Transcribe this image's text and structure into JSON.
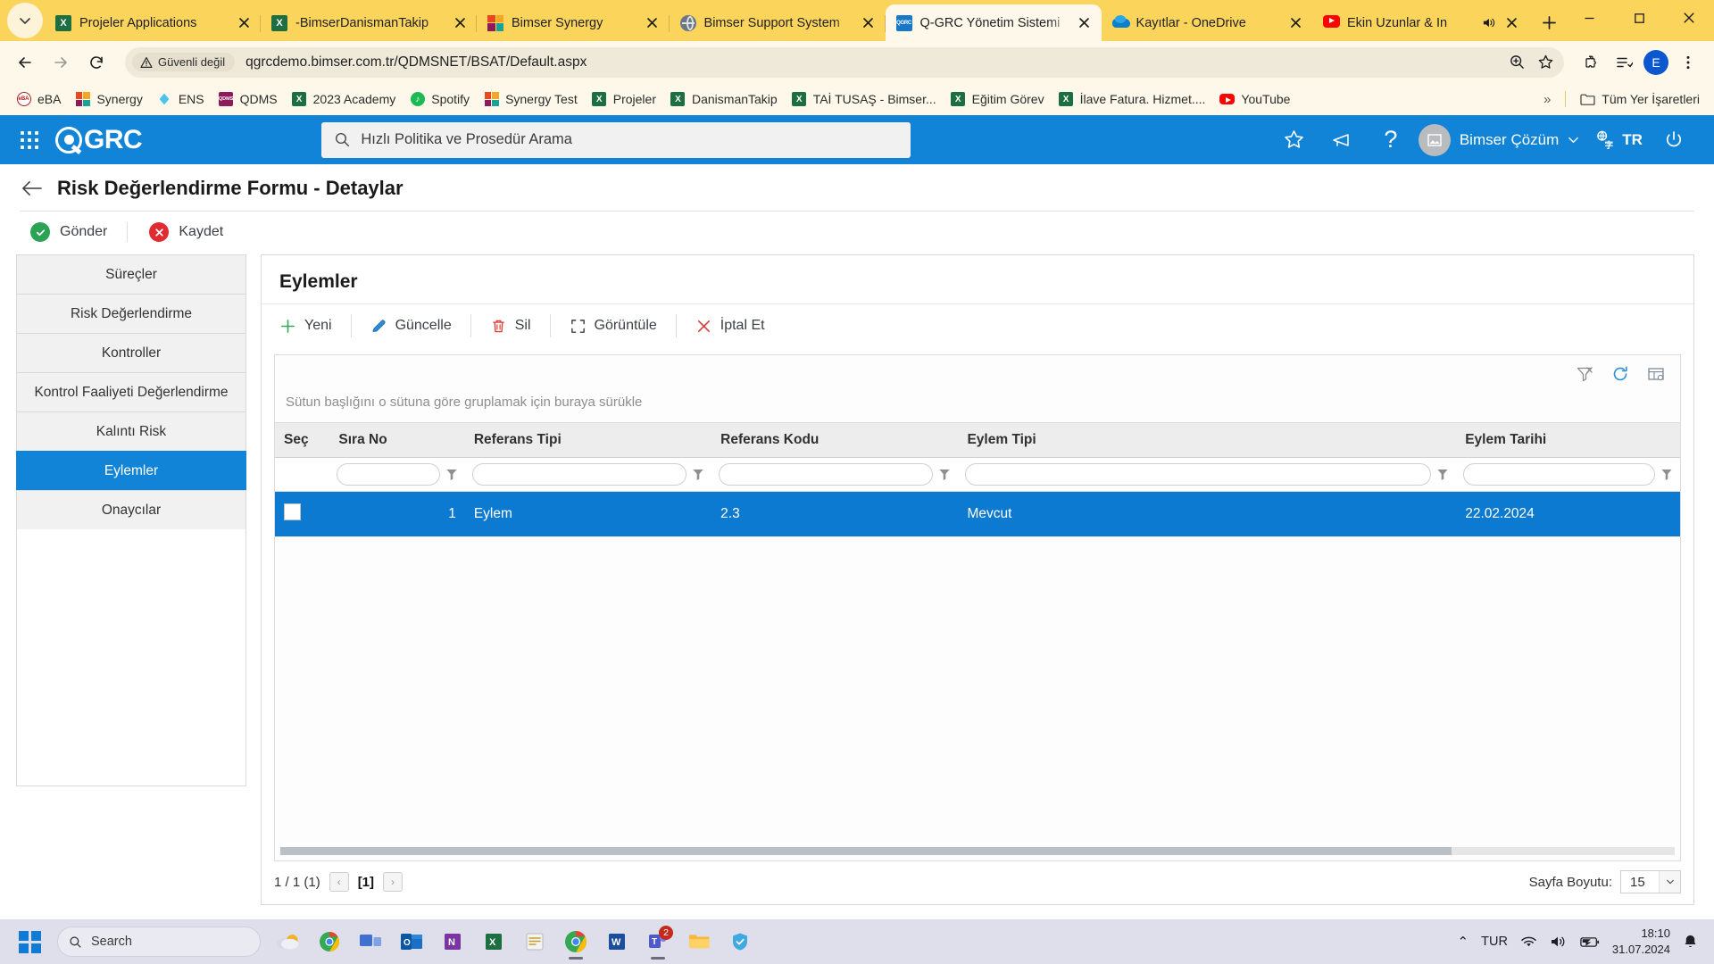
{
  "browser": {
    "tabs": [
      {
        "title": "Projeler Applications",
        "favicon": "excel-icon",
        "active": false,
        "muted": false
      },
      {
        "title": "-BimserDanismanTakip",
        "favicon": "excel-icon",
        "active": false,
        "muted": false
      },
      {
        "title": "Bimser Synergy",
        "favicon": "bimser-icon",
        "active": false,
        "muted": false
      },
      {
        "title": "Bimser Support System",
        "favicon": "globe-icon",
        "active": false,
        "muted": false
      },
      {
        "title": "Q-GRC Yönetim Sistemi",
        "favicon": "qgrc-icon",
        "active": true,
        "muted": false
      },
      {
        "title": "Kayıtlar - OneDrive",
        "favicon": "onedrive-icon",
        "active": false,
        "muted": false
      },
      {
        "title": "Ekin Uzunlar & In",
        "favicon": "youtube-icon",
        "active": false,
        "muted": true
      }
    ],
    "new_tab_label": "+",
    "window_controls": {
      "minimize": "—",
      "maximize": "▢",
      "close": "✕"
    },
    "omnibox": {
      "security_label": "Güvenli değil",
      "url": "qgrcdemo.bimser.com.tr/QDMSNET/BSAT/Default.aspx",
      "profile_initial": "E"
    },
    "bookmarks": [
      {
        "label": "eBA",
        "icon": "eba-icon"
      },
      {
        "label": "Synergy",
        "icon": "bimser-icon"
      },
      {
        "label": "ENS",
        "icon": "ens-icon"
      },
      {
        "label": "QDMS",
        "icon": "qdms-icon"
      },
      {
        "label": "2023 Academy",
        "icon": "excel-icon"
      },
      {
        "label": "Spotify",
        "icon": "spotify-icon"
      },
      {
        "label": "Synergy Test",
        "icon": "bimser-icon"
      },
      {
        "label": "Projeler",
        "icon": "excel-icon"
      },
      {
        "label": "DanismanTakip",
        "icon": "excel-icon"
      },
      {
        "label": "TAİ TUSAŞ - Bimser...",
        "icon": "excel-icon"
      },
      {
        "label": "Eğitim Görev",
        "icon": "excel-icon"
      },
      {
        "label": "İlave Fatura. Hizmet....",
        "icon": "excel-icon"
      },
      {
        "label": "YouTube",
        "icon": "youtube-icon"
      }
    ],
    "bookmarks_overflow": "»",
    "all_bookmarks_label": "Tüm Yer İşaretleri"
  },
  "app": {
    "brand": "GRC",
    "search_placeholder": "Hızlı Politika ve Prosedür Arama",
    "user_name": "Bimser Çözüm",
    "language": "TR",
    "accent_color": "#1184d8",
    "page_title": "Risk Değerlendirme Formu - Detaylar",
    "actions": [
      {
        "label": "Gönder",
        "icon": "check-circle-icon",
        "color": "#2aa355"
      },
      {
        "label": "Kaydet",
        "icon": "x-circle-icon",
        "color": "#e02b33"
      }
    ],
    "nav_items": [
      {
        "label": "Süreçler",
        "active": false
      },
      {
        "label": "Risk Değerlendirme",
        "active": false
      },
      {
        "label": "Kontroller",
        "active": false
      },
      {
        "label": "Kontrol Faaliyeti Değerlendirme",
        "active": false
      },
      {
        "label": "Kalıntı Risk",
        "active": false
      },
      {
        "label": "Eylemler",
        "active": true
      },
      {
        "label": "Onaycılar",
        "active": false
      }
    ],
    "panel": {
      "title": "Eylemler",
      "toolbar": [
        {
          "label": "Yeni",
          "icon": "plus-icon"
        },
        {
          "label": "Güncelle",
          "icon": "pencil-icon"
        },
        {
          "label": "Sil",
          "icon": "trash-icon"
        },
        {
          "label": "Görüntüle",
          "icon": "expand-icon"
        },
        {
          "label": "İptal Et",
          "icon": "x-icon"
        }
      ],
      "grid_icons": [
        "clear-filter-icon",
        "refresh-icon",
        "column-chooser-icon"
      ],
      "group_hint": "Sütun başlığını o sütuna göre gruplamak için buraya sürükle",
      "columns": [
        {
          "key": "sec",
          "label": "Seç"
        },
        {
          "key": "sira_no",
          "label": "Sıra No"
        },
        {
          "key": "referans_tipi",
          "label": "Referans Tipi"
        },
        {
          "key": "referans_kodu",
          "label": "Referans Kodu"
        },
        {
          "key": "eylem_tipi",
          "label": "Eylem Tipi"
        },
        {
          "key": "eylem_tarihi",
          "label": "Eylem Tarihi"
        }
      ],
      "filter_values": {
        "sira_no": "",
        "referans_tipi": "",
        "referans_kodu": "",
        "eylem_tipi": "",
        "eylem_tarihi": ""
      },
      "rows": [
        {
          "selected": true,
          "checked": false,
          "sira_no": "1",
          "referans_tipi": "Eylem",
          "referans_kodu": "2.3",
          "eylem_tipi": "Mevcut",
          "eylem_tarihi": "22.02.2024"
        }
      ],
      "pager": {
        "count_text": "1 / 1 (1)",
        "prev": "‹",
        "current": "[1]",
        "next": "›",
        "page_size_label": "Sayfa Boyutu:",
        "page_size_value": "15"
      }
    }
  },
  "taskbar": {
    "search_placeholder": "Search",
    "apps": [
      {
        "name": "widgets-weather-icon",
        "badge": ""
      },
      {
        "name": "chrome-beta-icon",
        "badge": ""
      },
      {
        "name": "task-view-icon",
        "badge": ""
      },
      {
        "name": "outlook-icon",
        "badge": ""
      },
      {
        "name": "onenote-icon",
        "badge": ""
      },
      {
        "name": "excel-icon",
        "badge": ""
      },
      {
        "name": "sticky-notes-icon",
        "badge": ""
      },
      {
        "name": "chrome-icon",
        "badge": ""
      },
      {
        "name": "word-icon",
        "badge": ""
      },
      {
        "name": "teams-icon",
        "badge": "2"
      },
      {
        "name": "file-explorer-icon",
        "badge": ""
      },
      {
        "name": "security-icon",
        "badge": ""
      }
    ],
    "tray": {
      "chevron": "⌃",
      "language": "TUR",
      "time": "18:10",
      "date": "31.07.2024"
    }
  }
}
